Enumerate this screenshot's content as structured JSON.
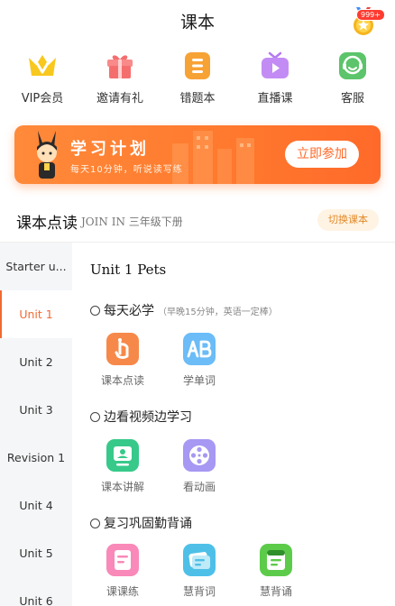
{
  "header": {
    "title": "课本",
    "medal_badge": "999+"
  },
  "menu": [
    {
      "label": "VIP会员",
      "icon": "vip-crown-icon",
      "color": "#f7c51b"
    },
    {
      "label": "邀请有礼",
      "icon": "gift-icon",
      "color": "#f77a7a"
    },
    {
      "label": "错题本",
      "icon": "mistake-book-icon",
      "color": "#f7a234"
    },
    {
      "label": "直播课",
      "icon": "live-tv-icon",
      "color": "#b57af0"
    },
    {
      "label": "客服",
      "icon": "customer-service-icon",
      "color": "#5cc46a"
    }
  ],
  "banner": {
    "title": "学习计划",
    "subtitle": "每天10分钟，听说读写练",
    "button": "立即参加",
    "color": "#ff7a2e"
  },
  "textbook": {
    "title": "课本点读",
    "series": "JOIN IN",
    "grade": "三年级下册",
    "switch_button": "切换课本"
  },
  "sidebar": {
    "items": [
      "Starter u...",
      "Unit 1",
      "Unit 2",
      "Unit 3",
      "Revision 1",
      "Unit 4",
      "Unit 5",
      "Unit 6"
    ],
    "active_index": 1
  },
  "main": {
    "unit_title": "Unit 1  Pets",
    "groups": [
      {
        "title": "每天必学",
        "note": "（早晚15分钟，英语一定棒）",
        "features": [
          {
            "label": "课本点读",
            "icon": "textbook-point-read-icon",
            "color": "#f6894a"
          },
          {
            "label": "学单词",
            "icon": "word-ab-icon",
            "color": "#5fb2f5"
          }
        ]
      },
      {
        "title": "边看视频边学习",
        "note": "",
        "features": [
          {
            "label": "课本讲解",
            "icon": "lecture-screen-icon",
            "color": "#37c98a"
          },
          {
            "label": "看动画",
            "icon": "film-reel-icon",
            "color": "#9a8ff0"
          }
        ]
      },
      {
        "title": "复习巩固勤背诵",
        "note": "",
        "features": [
          {
            "label": "课课练",
            "icon": "practice-doc-icon",
            "color": "#f57fb0"
          },
          {
            "label": "慧背词",
            "icon": "word-card-icon",
            "color": "#4ec0e8"
          },
          {
            "label": "慧背诵",
            "icon": "recite-book-icon",
            "color": "#5ccb4a"
          }
        ]
      }
    ]
  }
}
